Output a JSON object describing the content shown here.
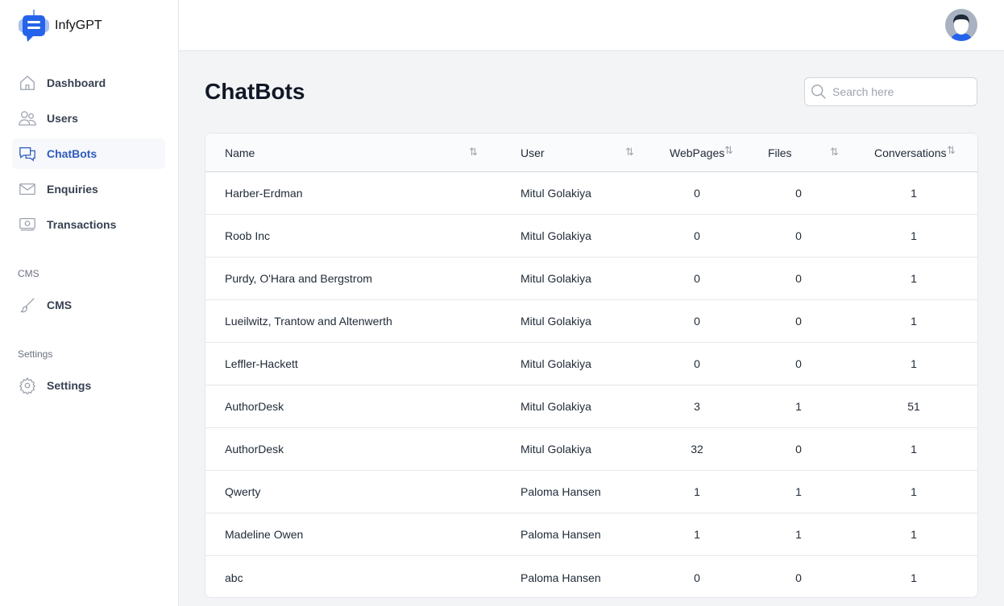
{
  "app": {
    "title": "InfyGPT"
  },
  "sidebar": {
    "items": [
      {
        "label": "Dashboard",
        "icon": "home-icon"
      },
      {
        "label": "Users",
        "icon": "users-icon"
      },
      {
        "label": "ChatBots",
        "icon": "chat-icon",
        "active": true
      },
      {
        "label": "Enquiries",
        "icon": "mail-icon"
      },
      {
        "label": "Transactions",
        "icon": "money-icon"
      }
    ],
    "cms_section": "CMS",
    "cms_item": {
      "label": "CMS",
      "icon": "brush-icon"
    },
    "settings_section": "Settings",
    "settings_item": {
      "label": "Settings",
      "icon": "gear-icon"
    }
  },
  "page": {
    "title": "ChatBots",
    "search_placeholder": "Search here"
  },
  "table": {
    "headers": [
      "Name",
      "User",
      "WebPages",
      "Files",
      "Conversations"
    ],
    "rows": [
      [
        "Harber-Erdman",
        "Mitul Golakiya",
        "0",
        "0",
        "1"
      ],
      [
        "Roob Inc",
        "Mitul Golakiya",
        "0",
        "0",
        "1"
      ],
      [
        "Purdy, O'Hara and Bergstrom",
        "Mitul Golakiya",
        "0",
        "0",
        "1"
      ],
      [
        "Lueilwitz, Trantow and Altenwerth",
        "Mitul Golakiya",
        "0",
        "0",
        "1"
      ],
      [
        "Leffler-Hackett",
        "Mitul Golakiya",
        "0",
        "0",
        "1"
      ],
      [
        "AuthorDesk",
        "Mitul Golakiya",
        "3",
        "1",
        "51"
      ],
      [
        "AuthorDesk",
        "Mitul Golakiya",
        "32",
        "0",
        "1"
      ],
      [
        "Qwerty",
        "Paloma Hansen",
        "1",
        "1",
        "1"
      ],
      [
        "Madeline Owen",
        "Paloma Hansen",
        "1",
        "1",
        "1"
      ],
      [
        "abc",
        "Paloma Hansen",
        "0",
        "0",
        "1"
      ]
    ]
  },
  "colors": {
    "accent": "#2f5bbd",
    "logo": "#2563eb"
  }
}
